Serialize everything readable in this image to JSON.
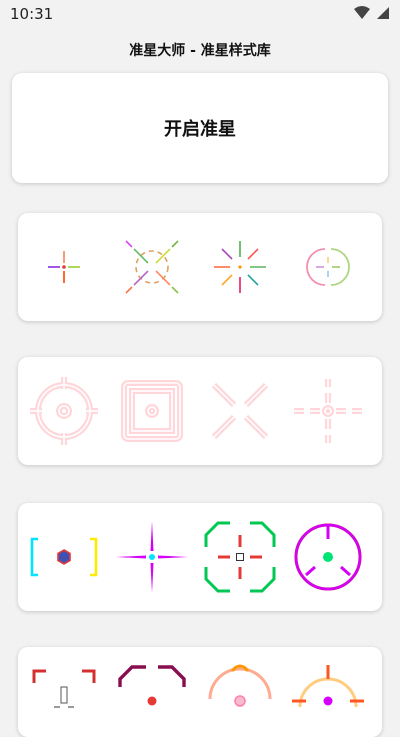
{
  "status_bar": {
    "time": "10:31",
    "icons": [
      "wifi-icon",
      "cellular-signal-icon"
    ]
  },
  "page": {
    "title": "准星大师 - 准星样式库"
  },
  "start_button": {
    "label": "开启准星"
  },
  "crosshair_rows": [
    {
      "styles": [
        "plus-dot-green-red",
        "circle-x-dashed-rainbow",
        "star-burst-rainbow",
        "circle-split-pastel"
      ]
    },
    {
      "styles": [
        "scope-glow-circle",
        "scope-glow-square",
        "x-glow",
        "dot-cross-glow"
      ]
    },
    {
      "styles": [
        "bracket-hexagon",
        "plus-magenta-cyan",
        "octagon-green-red",
        "circle-magenta-green-dot"
      ]
    },
    {
      "styles": [
        "corners-red",
        "octagon-crimson-dot",
        "arch-orange-pink",
        "circle-orange-magenta"
      ]
    }
  ],
  "colors": {
    "background": "#f2f2f2",
    "card": "#ffffff"
  }
}
